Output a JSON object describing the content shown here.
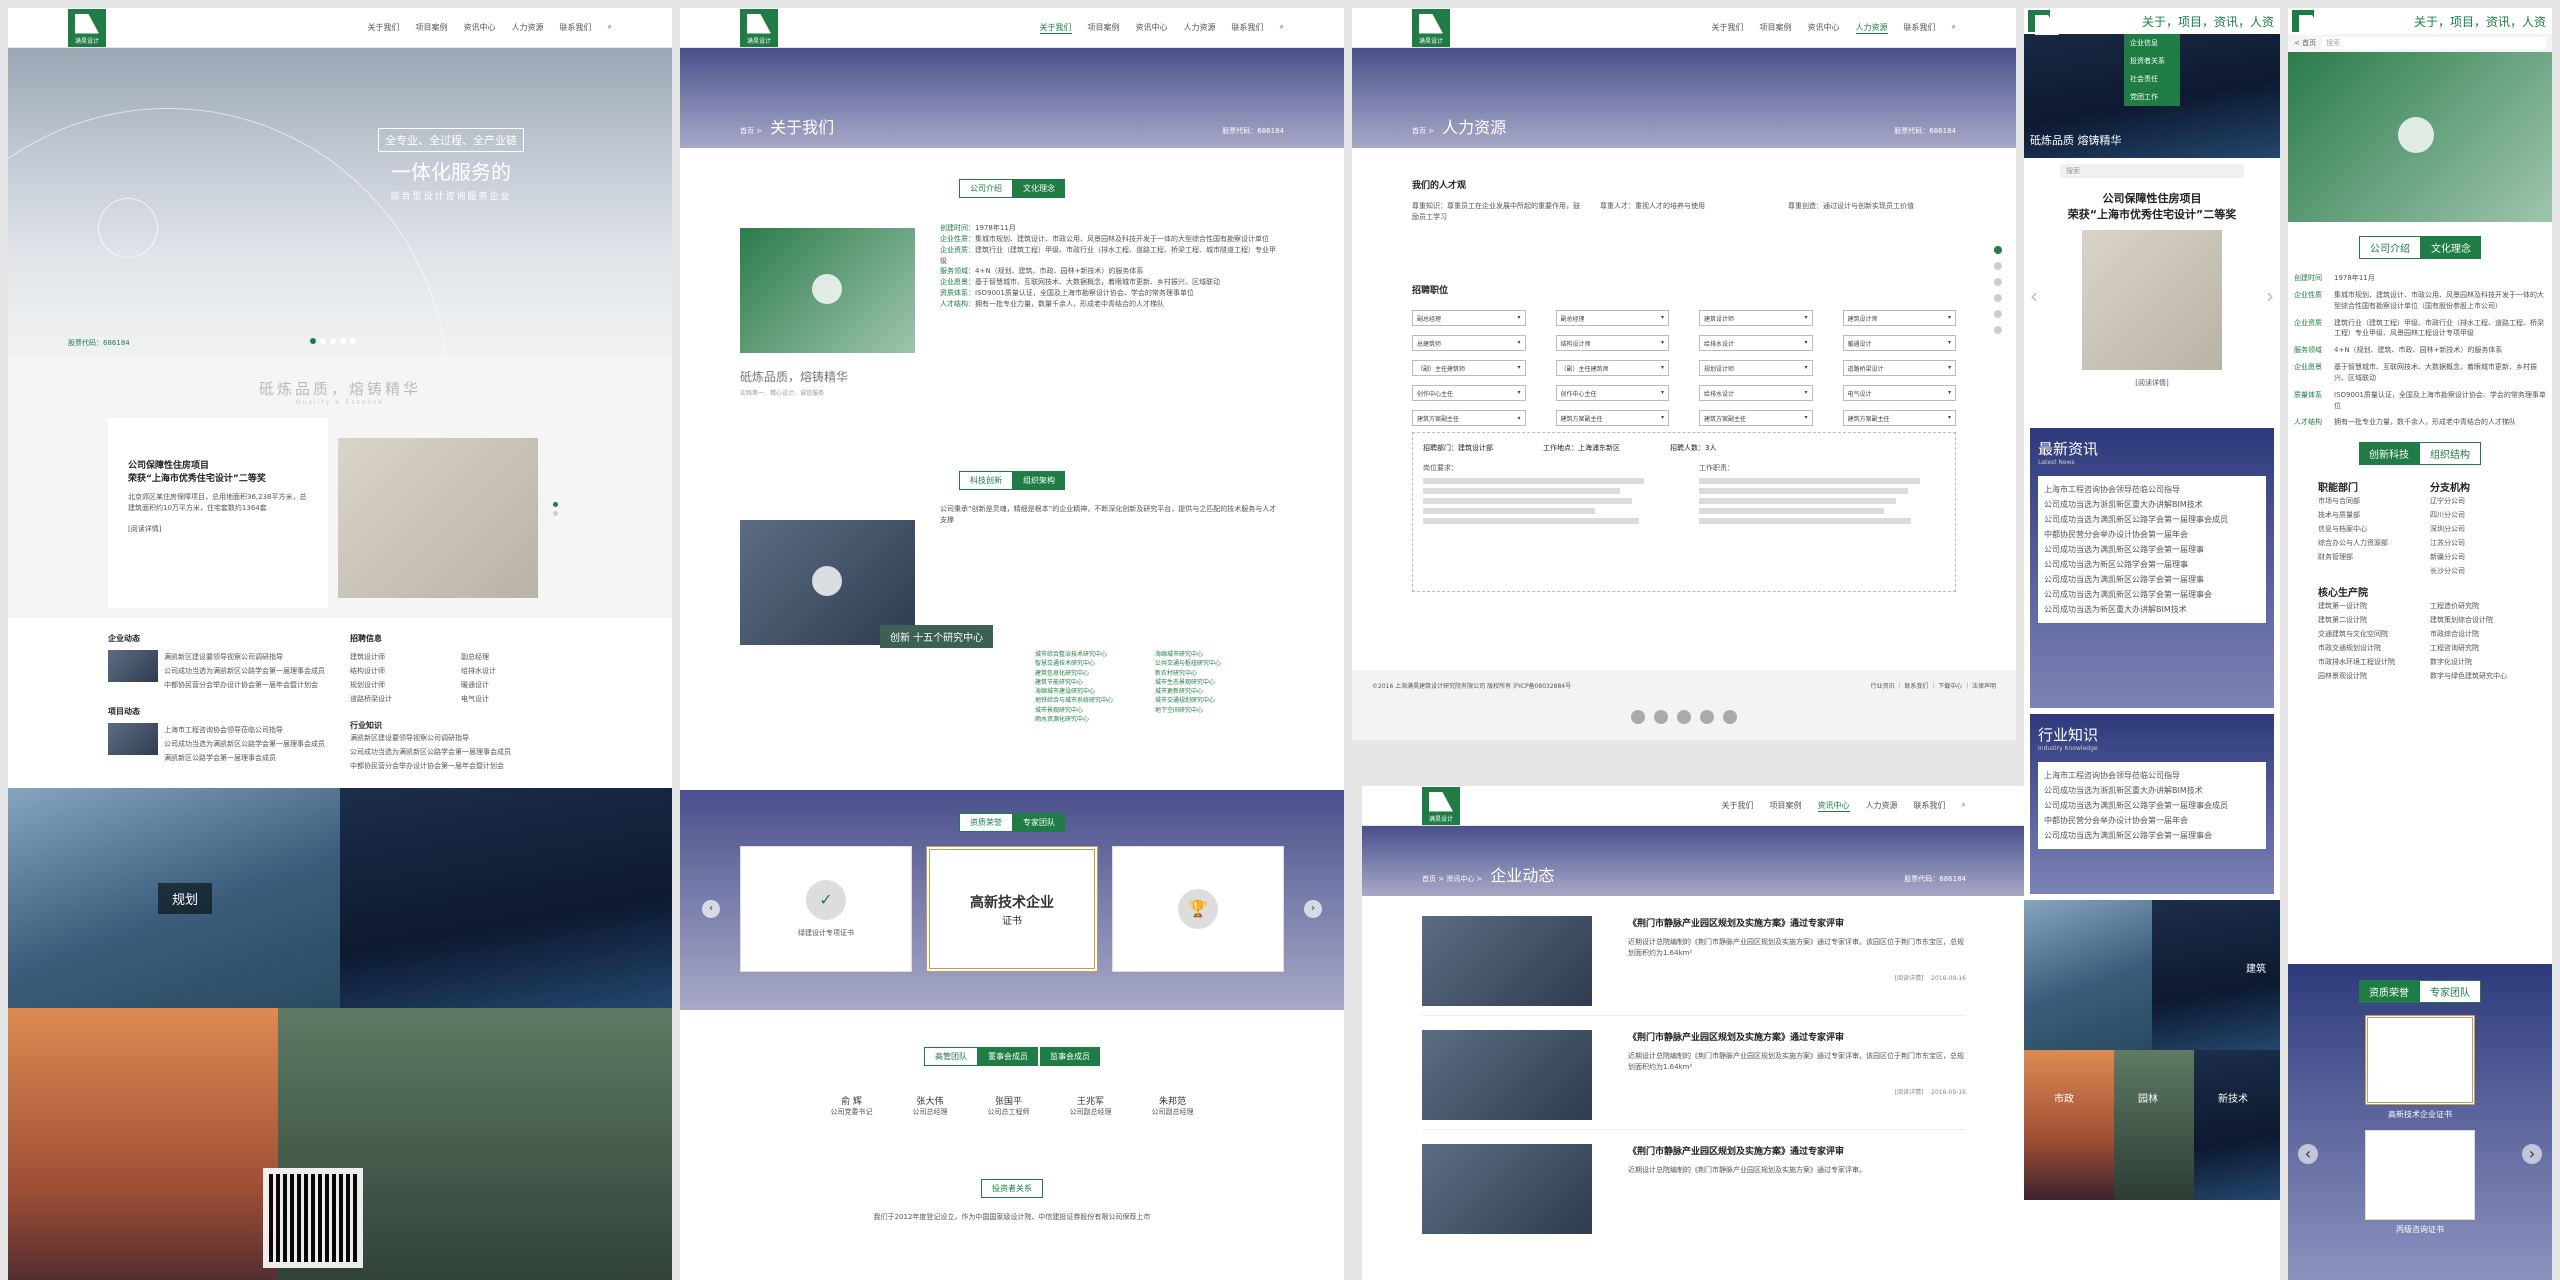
{
  "nav": {
    "items": [
      "关于我们",
      "项目案例",
      "资讯中心",
      "人力资源",
      "联系我们"
    ],
    "brand": "满昊设计"
  },
  "home": {
    "hero_l1": "全专业、全过程、全产业链",
    "hero_l2": "一体化服务的",
    "hero_l3": "综合型设计咨询服务企业",
    "code": "股票代码：686184",
    "slogan": "砥炼品质，熔铸精华",
    "slogan_en": "Quality & Essence",
    "proj_title": "公司保障性住房项目",
    "proj_sub": "荣获“上海市优秀住宅设计”二等奖",
    "proj_desc": "北京郊区某住房保障项目，总用地面积36,238平方米，总建筑面积约10万平方米，住宅套数约1364套",
    "more": "[阅读详情]",
    "news1": "企业动态",
    "news1_items": [
      "满凯新区建设要领导视察公司调研指导",
      "公司成功当选为满凯新区公路学会第一届理事会成员",
      "中都协民营分会举办设计协会第一届年会暨计划会"
    ],
    "news2": "项目动态",
    "news2_items": [
      "上海市工程咨询协会领导莅临公司指导",
      "公司成功当选为满凯新区公路学会第一届理事会成员",
      "满凯新区公路学会第一届理事会成员"
    ],
    "jobs": "招聘信息",
    "jobs_items": [
      "建筑设计师",
      "副总经理",
      "结构设计师",
      "给排水设计",
      "规划设计师",
      "暖通设计",
      "道路桥梁设计",
      "电气设计"
    ],
    "know": "行业知识",
    "know_items": [
      "满凯新区建设要领导视察公司调研指导",
      "公司成功当选为满凯新区公路学会第一届理事会成员",
      "中都协民营分会举办设计协会第一届年会暨计划会"
    ],
    "plan": "规划"
  },
  "about": {
    "crumb": "首页 >",
    "title": "关于我们",
    "code": "股票代码：686184",
    "tab1": "公司介绍",
    "tab2": "文化理念",
    "rows": [
      [
        "创建时间",
        "1978年11月"
      ],
      [
        "企业性质",
        "集城市规划、建筑设计、市政公用、风景园林及科技开发于一体的大型综合性国有勘察设计单位"
      ],
      [
        "企业资质",
        "建筑行业（建筑工程）甲级、市政行业（排水工程、道路工程、桥梁工程、城市隧道工程）专业甲级"
      ],
      [
        "服务领域",
        "4+N（规划、建筑、市政、园林+新技术）的服务体系"
      ],
      [
        "企业愿景",
        "基于智慧城市、互联网技术、大数据概念，着眼城市更新、乡村振兴、区域联动"
      ],
      [
        "资质体系",
        "ISO9001质量认证，全国及上海市勘察设计协会、学会的常务理事单位"
      ],
      [
        "人才结构",
        "拥有一批专业力量，数量千余人，形成老中青结合的人才梯队"
      ]
    ],
    "caption": "砥炼品质，熔铸精华",
    "caption_sub": "实践第一、精心设计、诚信服务",
    "tab3": "科技创新",
    "tab4": "组织架构",
    "innov_text": "公司秉承“创新是灵魂，精细是根本”的企业精神，不断深化创新及研究平台，提供与之匹配的技术服务与人才支撑",
    "innov_label": "创新  十五个研究中心",
    "centers": [
      "城市综合整治技术研究中心",
      "海绵城市研究中心",
      "智慧交通技术研究中心",
      "公共交通与枢纽研究中心",
      "建筑信息化研究中心",
      "新农村研究中心",
      "建筑节能研究中心",
      "城市生态景观研究中心",
      "海绵城市建设研究中心",
      "城市更新研究中心",
      "地铁综合与城市系统研究中心",
      "城市交通规划研究中心",
      "城市景观研究中心",
      "地下空间研究中心",
      "雨水资源化研究中心"
    ],
    "tab5": "资质荣誉",
    "tab6": "专家团队",
    "certs": [
      "绿建设计专项证书",
      "高新技术企业",
      "证书"
    ],
    "tab7": "高管团队",
    "tab8": "董事会成员",
    "tab9": "监事会成员",
    "people": [
      [
        "俞  辉",
        "公司党委书记"
      ],
      [
        "张大伟",
        "公司总经理"
      ],
      [
        "张国平",
        "公司总工程师"
      ],
      [
        "王兆军",
        "公司副总经理"
      ],
      [
        "朱邦范",
        "公司副总经理"
      ]
    ],
    "tab10": "投资者关系",
    "inv_text": "我们于2012年度登记设立，作为中国国家级设计院、中信建投证券股份有限公司保荐上市"
  },
  "hr": {
    "crumb": "首页 >",
    "title": "人力资源",
    "code": "股票代码：686184",
    "h1": "我们的人才观",
    "cols": [
      "尊重知识：尊重员工在企业发展中所起的重要作用，鼓励员工学习",
      "尊重人才：重视人才的培养与使用",
      "尊重创造：通过设计与创新实现员工价值"
    ],
    "h2": "招聘职位",
    "fields": [
      "副总经理",
      "副总经理",
      "建筑设计师",
      "建筑设计师",
      "总建筑师",
      "结构设计师",
      "给排水设计",
      "暖通设计",
      "（副）主任建筑师",
      "（副）主任建筑师",
      "规划设计师",
      "道路桥梁设计",
      "创作中心主任",
      "创作中心主任",
      "给排水设计",
      "电气设计",
      "建筑方案副主任",
      "建筑方案副主任",
      "建筑方案副主任",
      "建筑方案副主任"
    ],
    "job_dept": "招聘部门：建筑设计部",
    "job_place": "工作地点：上海浦东新区",
    "job_num": "招聘人数：3人",
    "req": "岗位要求：",
    "duty": "工作职责：",
    "foot": "©2016 上海满昊建筑设计研究院有限公司 版权所有 沪ICP备08032884号",
    "foot_links": "行业资讯 ｜ 联系我们 ｜ 下载中心 ｜ 法律声明"
  },
  "news": {
    "crumb": "首页 > 资讯中心 >",
    "title": "企业动态",
    "code": "股票代码：686184",
    "items": [
      {
        "t": "《荆门市静脉产业园区规划及实施方案》通过专家评审",
        "d": "近期设计总院编制的《荆门市静脉产业园区规划及实施方案》通过专家评审。该园区位于荆门市东宝区，总规划面积约为1.64km²",
        "date": "2016-09-16",
        "more": "[阅读详情]"
      },
      {
        "t": "《荆门市静脉产业园区规划及实施方案》通过专家评审",
        "d": "近期设计总院编制的《荆门市静脉产业园区规划及实施方案》通过专家评审。该园区位于荆门市东宝区，总规划面积约为1.64km²",
        "date": "2016-09-16",
        "more": "[阅读详情]"
      },
      {
        "t": "《荆门市静脉产业园区规划及实施方案》通过专家评审",
        "d": "近期设计总院编制的《荆门市静脉产业园区规划及实施方案》通过专家评审。",
        "date": "2016-09-16",
        "more": "[阅读详情]"
      }
    ]
  },
  "mobile1": {
    "nav": "关于，项目，资讯，人资",
    "menu": [
      "企业信息",
      "投资者关系",
      "社会责任",
      "党团工作"
    ],
    "brand": "砥炼品质 熔铸精华",
    "search": "搜索",
    "proj_title": "公司保障性住房项目",
    "proj_sub": "荣获“上海市优秀住宅设计”二等奖",
    "more": "[阅读详情]",
    "news": "最新资讯",
    "news_en": "Latest News",
    "news_items": [
      "上海市工程咨询协会领导莅临公司指导",
      "公司成功当选为浙凯新区重大办讲解BIM技术",
      "公司成功当选为满凯新区公路学会第一届理事会成员",
      "中都协民营分会举办设计协会第一届年会",
      "公司成功当选为满凯新区公路学会第一届理事",
      "公司成功当选为新区公路学会第一届理事",
      "公司成功当选为满凯新区公路学会第一届理事",
      "公司成功当选为满凯新区公路学会第一届理事会",
      "公司成功当选为新区重大办讲解BIM技术"
    ],
    "know": "行业知识",
    "know_en": "Industry Knowledge",
    "know_items": [
      "上海市工程咨询协会领导莅临公司指导",
      "公司成功当选为浙凯新区重大办讲解BIM技术",
      "公司成功当选为满凯新区公路学会第一届理事会成员",
      "中都协民营分会举办设计协会第一届年会",
      "公司成功当选为满凯新区公路学会第一届理事会"
    ],
    "tiles": [
      "建筑",
      "市政",
      "园林",
      "新技术"
    ]
  },
  "mobile2": {
    "nav": "关于，项目，资讯，人资",
    "back": "< 首页",
    "search": "搜索",
    "tab1": "公司介绍",
    "tab2": "文化理念",
    "rows": [
      [
        "创建时间",
        "1978年11月"
      ],
      [
        "企业性质",
        "集城市规划、建筑设计、市政公用、风景园林及科技开发于一体的大型综合性国有勘察设计单位（国有股份参股上市公司）"
      ],
      [
        "企业资质",
        "建筑行业（建筑工程）甲级、市政行业（排水工程、道路工程、桥梁工程）专业甲级、风景园林工程设计专项甲级"
      ],
      [
        "服务领域",
        "4+N（规划、建筑、市政、园林+新技术）的服务体系"
      ],
      [
        "企业愿景",
        "基于智慧城市、互联网技术、大数据概念，着眼城市更新、乡村振兴、区域联动"
      ],
      [
        "质量体系",
        "ISO9001质量认证，全国及上海市勘察设计协会、学会的常务理事单位"
      ],
      [
        "人才结构",
        "拥有一批专业力量，数千余人，形成老中青结合的人才梯队"
      ]
    ],
    "tab3": "创新科技",
    "tab4": "组织结构",
    "org1": "职能部门",
    "org2": "分支机构",
    "org1_items": [
      "市场与合同部",
      "技术与质量部",
      "信息与档案中心",
      "综合办公与人力资源部",
      "财务管理部"
    ],
    "org2_items": [
      "辽宁分公司",
      "四川分公司",
      "深圳分公司",
      "江苏分公司",
      "新疆分公司",
      "长沙分公司"
    ],
    "org3": "核心生产院",
    "org3_items": [
      "建筑第一设计院",
      "建筑第二设计院",
      "交通建筑与文化空间院",
      "市政交通规划设计院",
      "市政排水环境工程设计院",
      "园林景观设计院"
    ],
    "org3b": [
      "工程造价研究院",
      "建筑策划综合设计院",
      "市政综合设计院",
      "工程咨询研究院",
      "数字化设计院",
      "数字与绿色建筑研究中心"
    ],
    "tab5": "资质荣誉",
    "tab6": "专家团队",
    "cert1": "高新技术企业证书",
    "cert2": "丙级咨询证书"
  }
}
